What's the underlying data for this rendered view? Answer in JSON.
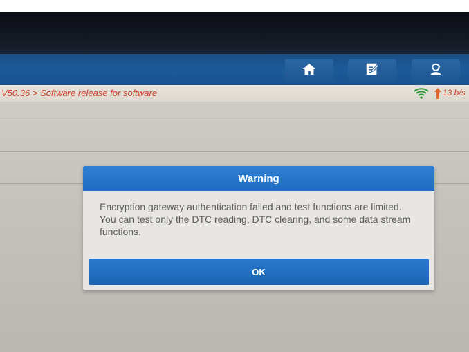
{
  "toolbar": {
    "buttons": [
      {
        "name": "home",
        "icon": "home-icon"
      },
      {
        "name": "report",
        "icon": "edit-report-icon"
      },
      {
        "name": "support",
        "icon": "support-agent-icon"
      }
    ]
  },
  "breadcrumb": {
    "text": "V50.36 > Software release for software"
  },
  "status": {
    "wifi_icon": "wifi-icon",
    "speed": "13 b/s",
    "speed_color": "#c94a2d"
  },
  "dialog": {
    "title": "Warning",
    "message": "Encryption gateway authentication failed and test functions are limited. You can test only the DTC reading, DTC clearing, and some data stream functions.",
    "ok_label": "OK",
    "accent_color": "#1f6cc0"
  }
}
